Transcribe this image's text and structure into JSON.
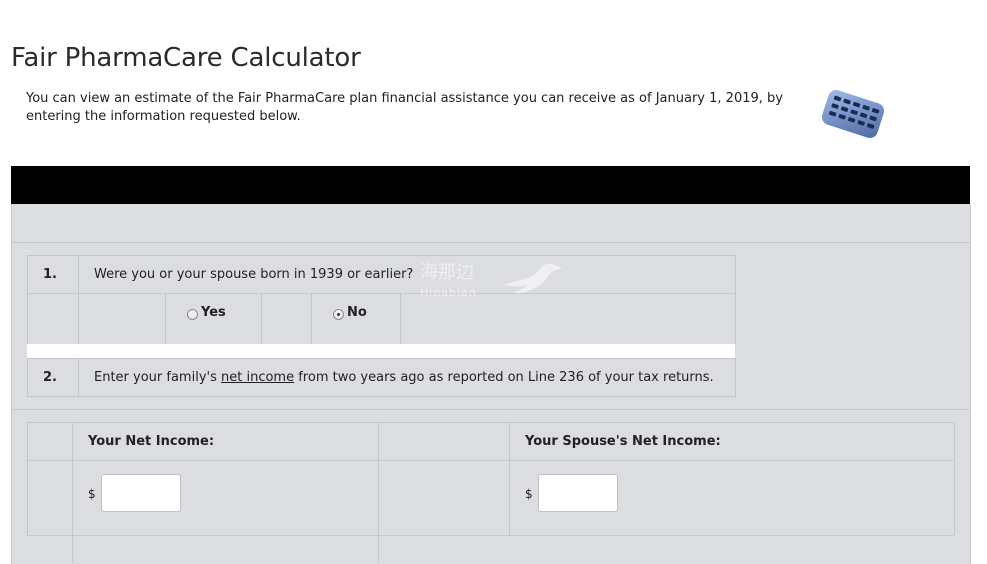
{
  "page": {
    "title": "Fair PharmaCare Calculator",
    "intro": "You can view an estimate of the Fair PharmaCare plan financial assistance you can receive as of January 1, 2019, by entering the information requested below."
  },
  "question1": {
    "number": "1.",
    "text": "Were you or your spouse born in 1939 or earlier?",
    "options": [
      {
        "label": "Yes",
        "checked": false
      },
      {
        "label": "No",
        "checked": true
      }
    ]
  },
  "question2": {
    "number": "2.",
    "text_before": "Enter your family's ",
    "link": "net income",
    "text_after": " from two years ago as reported on Line 236 of your tax returns."
  },
  "income": {
    "your_label": "Your Net Income:",
    "spouse_label": "Your Spouse's Net Income:",
    "currency": "$",
    "your_value": "",
    "spouse_value": ""
  },
  "watermark": {
    "text": "海那边",
    "sub": "Hinabian"
  },
  "icons": {
    "calculator": "calculator-icon"
  },
  "colors": {
    "panel": "#dcdde1",
    "band": "#000000"
  }
}
